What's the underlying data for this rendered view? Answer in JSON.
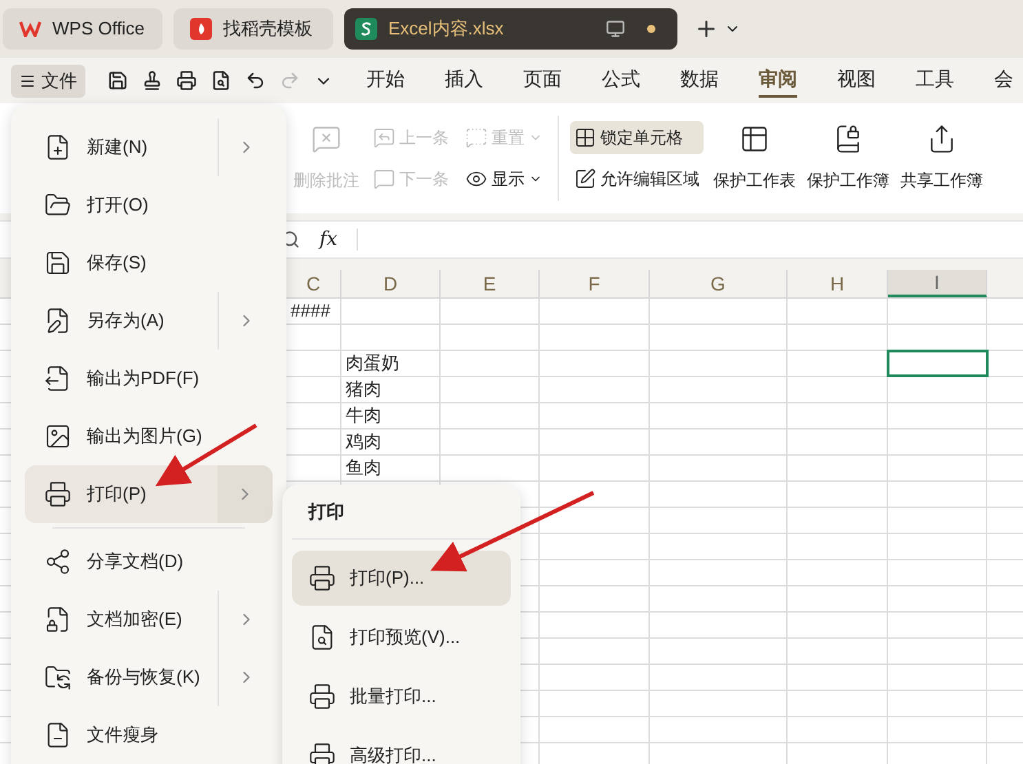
{
  "tabs": [
    {
      "label": "WPS Office",
      "kind": "home",
      "selected": false
    },
    {
      "label": "找稻壳模板",
      "kind": "template",
      "selected": false
    },
    {
      "label": "Excel内容.xlsx",
      "kind": "sheet",
      "selected": true
    }
  ],
  "file_button": {
    "label": "文件"
  },
  "ribbon_tabs": [
    {
      "label": "开始",
      "selected": false
    },
    {
      "label": "插入",
      "selected": false
    },
    {
      "label": "页面",
      "selected": false
    },
    {
      "label": "公式",
      "selected": false
    },
    {
      "label": "数据",
      "selected": false
    },
    {
      "label": "审阅",
      "selected": true
    },
    {
      "label": "视图",
      "selected": false
    },
    {
      "label": "工具",
      "selected": false
    },
    {
      "label": "会",
      "selected": false
    }
  ],
  "ribbon_columns": [
    {
      "kind": "large",
      "items": [
        {
          "label": "删除批注",
          "disabled": true,
          "on": false,
          "has_menu": false
        }
      ]
    },
    {
      "kind": "stack",
      "items": [
        {
          "label": "上一条",
          "disabled": true,
          "on": false,
          "has_menu": false
        },
        {
          "label": "下一条",
          "disabled": true,
          "on": false,
          "has_menu": false
        }
      ]
    },
    {
      "kind": "stack",
      "items": [
        {
          "label": "重置",
          "disabled": true,
          "on": false,
          "has_menu": true
        },
        {
          "label": "显示",
          "disabled": false,
          "on": false,
          "has_menu": true
        }
      ]
    },
    {
      "kind": "divider"
    },
    {
      "kind": "stack",
      "items": [
        {
          "label": "锁定单元格",
          "disabled": false,
          "on": true,
          "has_menu": false
        },
        {
          "label": "允许编辑区域",
          "disabled": false,
          "on": false,
          "has_menu": false
        }
      ]
    },
    {
      "kind": "large",
      "items": [
        {
          "label": "保护工作表",
          "disabled": false,
          "on": false,
          "has_menu": false
        }
      ]
    },
    {
      "kind": "large",
      "items": [
        {
          "label": "保护工作簿",
          "disabled": false,
          "on": false,
          "has_menu": false
        }
      ]
    },
    {
      "kind": "large",
      "items": [
        {
          "label": "共享工作簿",
          "disabled": false,
          "on": false,
          "has_menu": false
        }
      ]
    }
  ],
  "formula_bar": {
    "function_label": "fx"
  },
  "sheet": {
    "columns": [
      {
        "label": "C",
        "selected": false
      },
      {
        "label": "D",
        "selected": false
      },
      {
        "label": "E",
        "selected": false
      },
      {
        "label": "F",
        "selected": false
      },
      {
        "label": "G",
        "selected": false
      },
      {
        "label": "H",
        "selected": false
      },
      {
        "label": "I",
        "selected": true
      }
    ],
    "rows": [
      {
        "selected": false,
        "cells": [
          "####",
          null,
          null,
          null,
          null,
          null,
          null
        ]
      },
      {
        "selected": false,
        "cells": [
          null,
          null,
          null,
          null,
          null,
          null,
          null
        ]
      },
      {
        "selected": true,
        "cells": [
          null,
          "肉蛋奶",
          null,
          null,
          null,
          null,
          null
        ]
      },
      {
        "selected": false,
        "cells": [
          null,
          "猪肉",
          null,
          null,
          null,
          null,
          null
        ]
      },
      {
        "selected": false,
        "cells": [
          null,
          "牛肉",
          null,
          null,
          null,
          null,
          null
        ]
      },
      {
        "selected": false,
        "cells": [
          null,
          "鸡肉",
          null,
          null,
          null,
          null,
          null
        ]
      },
      {
        "selected": false,
        "cells": [
          null,
          "鱼肉",
          null,
          null,
          null,
          null,
          null
        ]
      }
    ]
  },
  "file_menu": {
    "items": [
      {
        "label": "新建(N)",
        "has_submenu": true,
        "selected": false
      },
      {
        "label": "打开(O)",
        "has_submenu": false,
        "selected": false
      },
      {
        "label": "保存(S)",
        "has_submenu": false,
        "selected": false
      },
      {
        "label": "另存为(A)",
        "has_submenu": true,
        "selected": false
      },
      {
        "label": "输出为PDF(F)",
        "has_submenu": false,
        "selected": false
      },
      {
        "label": "输出为图片(G)",
        "has_submenu": false,
        "selected": false
      },
      {
        "label": "打印(P)",
        "has_submenu": true,
        "selected": true
      },
      {
        "label": "分享文档(D)",
        "has_submenu": false,
        "selected": false
      },
      {
        "label": "文档加密(E)",
        "has_submenu": true,
        "selected": false
      },
      {
        "label": "备份与恢复(K)",
        "has_submenu": true,
        "selected": false
      },
      {
        "label": "文件瘦身",
        "has_submenu": false,
        "selected": false
      }
    ]
  },
  "print_submenu": {
    "title": "打印",
    "items": [
      {
        "label": "打印(P)...",
        "selected": true
      },
      {
        "label": "打印预览(V)...",
        "selected": false
      },
      {
        "label": "批量打印...",
        "selected": false
      },
      {
        "label": "高级打印...",
        "selected": false
      }
    ]
  }
}
